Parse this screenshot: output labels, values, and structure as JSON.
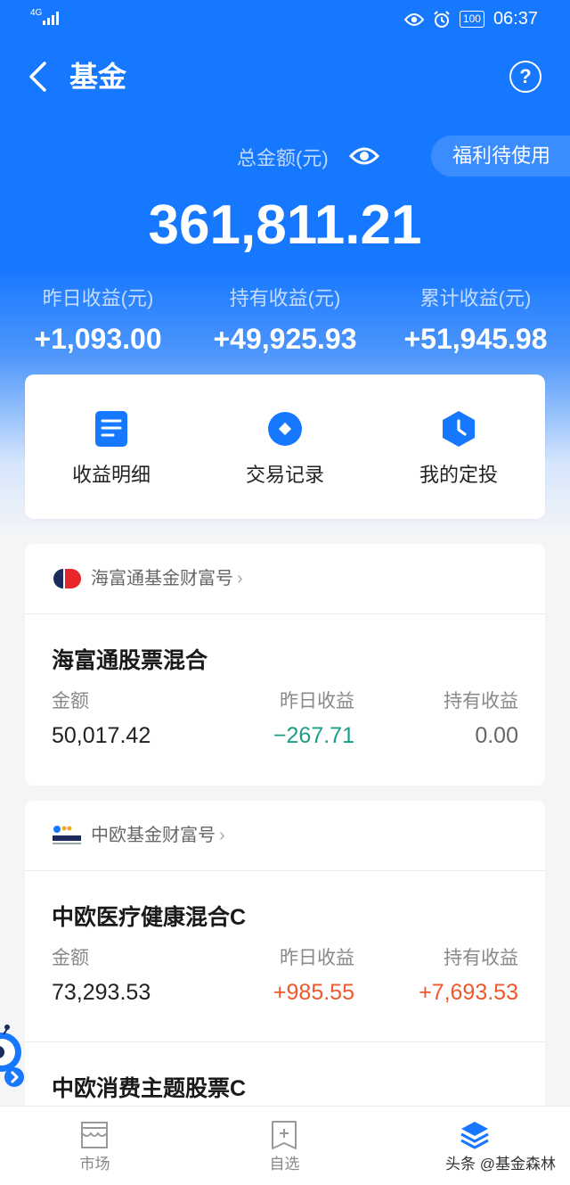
{
  "status_bar": {
    "network": "4G",
    "battery": "100",
    "time": "06:37"
  },
  "nav": {
    "title": "基金",
    "help": "?"
  },
  "summary": {
    "total_label": "总金额(元)",
    "welfare_button": "福利待使用",
    "total_amount": "361,811.21",
    "stats": [
      {
        "label": "昨日收益(元)",
        "value": "+1,093.00"
      },
      {
        "label": "持有收益(元)",
        "value": "+49,925.93"
      },
      {
        "label": "累计收益(元)",
        "value": "+51,945.98"
      }
    ]
  },
  "actions": [
    {
      "label": "收益明细",
      "icon": "document-icon"
    },
    {
      "label": "交易记录",
      "icon": "record-icon"
    },
    {
      "label": "我的定投",
      "icon": "clock-icon"
    }
  ],
  "col_labels": {
    "amount": "金额",
    "yesterday": "昨日收益",
    "holding": "持有收益"
  },
  "cards": [
    {
      "company": "海富通基金财富号",
      "funds": [
        {
          "name": "海富通股票混合",
          "amount": "50,017.42",
          "yesterday": "−267.71",
          "holding": "0.00"
        }
      ]
    },
    {
      "company": "中欧基金财富号",
      "funds": [
        {
          "name": "中欧医疗健康混合C",
          "amount": "73,293.53",
          "yesterday": "+985.55",
          "holding": "+7,693.53"
        },
        {
          "name": "中欧消费主题股票C"
        }
      ]
    }
  ],
  "tabbar": {
    "tabs": [
      {
        "label": "市场",
        "icon": "market-icon"
      },
      {
        "label": "自选",
        "icon": "watchlist-icon"
      },
      {
        "label": "",
        "icon": "holdings-icon"
      }
    ]
  },
  "watermark": "头条 @基金森林",
  "colors": {
    "brand_blue": "#1677ff",
    "loss_green": "#1b9e86",
    "gain_red": "#f0572b"
  }
}
